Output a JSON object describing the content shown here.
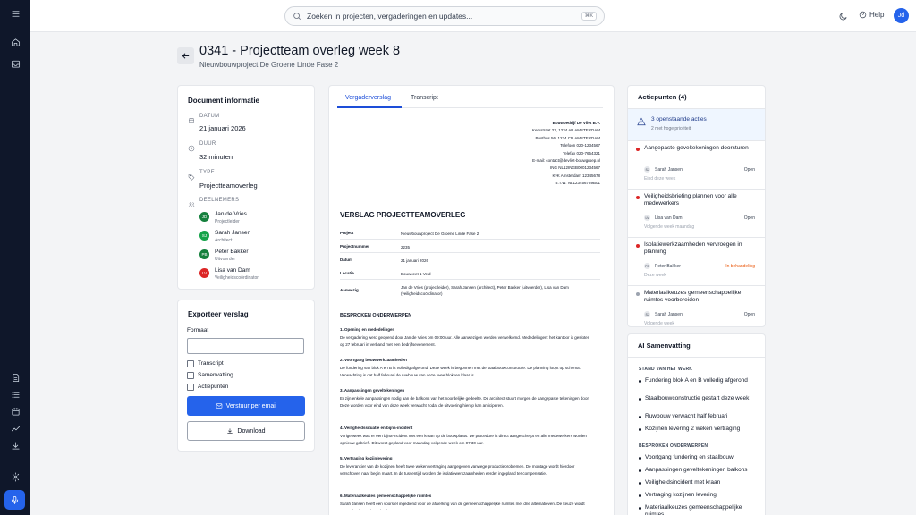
{
  "search": {
    "placeholder": "Zoeken in projecten, vergaderingen en updates...",
    "shortcut": "⌘K"
  },
  "header": {
    "help": "Help",
    "avatar": "Jd"
  },
  "page": {
    "title": "0341 - Projectteam overleg week 8",
    "subtitle": "Nieuwbouwproject De Groene Linde Fase 2"
  },
  "doc_info": {
    "title": "Document informatie",
    "date_label": "DATUM",
    "date": "21 januari 2026",
    "duration_label": "DUUR",
    "duration": "32 minuten",
    "type_label": "TYPE",
    "type": "Projectteamoverleg",
    "participants_label": "DEELNEMERS",
    "participants": [
      {
        "initials": "JD",
        "name": "Jan de Vries",
        "role": "Projectleider",
        "color": "#15803d"
      },
      {
        "initials": "SJ",
        "name": "Sarah Jansen",
        "role": "Architect",
        "color": "#16a34a"
      },
      {
        "initials": "PB",
        "name": "Peter Bakker",
        "role": "Uitvoerder",
        "color": "#15803d"
      },
      {
        "initials": "LV",
        "name": "Lisa van Dam",
        "role": "Veiligheidscoördinator",
        "color": "#dc2626"
      }
    ]
  },
  "export": {
    "title": "Exporteer verslag",
    "format_label": "Formaat",
    "format_value": "",
    "options": [
      "Transcript",
      "Samenvatting",
      "Actiepunten"
    ],
    "email_button": "Verstuur per email",
    "download_button": "Download"
  },
  "tabs": [
    "Vergaderverslag",
    "Transcript"
  ],
  "document": {
    "company": [
      "Bouwbedrijf De Vliet B.V.",
      "Kerkstraat 27, 1234 AB AMSTERDAM",
      "Postbus 56, 1234 CD AMSTERDAM",
      "Telefoon 020-1234567",
      "Telefax 020-7654321",
      "E-mail: contact@devliet-bouwgroep.nl",
      "ING NL12INGB0001234567",
      "KvK Amsterdam 12345678",
      "B.T.W. NL123456789B01"
    ],
    "title": "VERSLAG PROJECTTEAMOVERLEG",
    "meta": [
      {
        "k": "Project",
        "v": "Nieuwbouwproject De Groene Linde Fase 2"
      },
      {
        "k": "Projectnummer",
        "v": "2235"
      },
      {
        "k": "Datum",
        "v": "21 januari 2026"
      },
      {
        "k": "Locatie",
        "v": "Bouwkeet 1 Veld"
      },
      {
        "k": "Aanwezig",
        "v": "Jan de Vries (projectleider), Sarah Jansen (architect), Peter Bakker (uitvoerder), Lisa van Dam (veiligheidscoördinator)"
      }
    ],
    "section_title": "BESPROKEN ONDERWERPEN",
    "topics": [
      {
        "h": "1. Opening en mededelingen",
        "p": "De vergadering werd geopend door Jan de Vries om 09:00 uur. Alle aanwezigen werden verwelkomd. Mededelingen: het kantoor is gesloten op 27 februari in verband met een bedrijfsevenement."
      },
      {
        "h": "2. Voortgang bouwwerkzaamheden",
        "p": "De fundering van blok A en B is volledig afgerond. Deze week is begonnen met de staalbouwconstructie. De planning loopt op schema. Verwachting is dat half februari de ruwbouw van deze twee blokken klaar is."
      },
      {
        "h": "3. Aanpassingen gevelteken­ingen",
        "p": "Er zijn enkele aanpassingen nodig aan de balkons van het noordelijke gedeelte. De architect stuurt morgen de aangepaste tekeningen door. Deze worden voor eind van deze week verwacht zodat de uitvoering hierop kan anticiperen."
      },
      {
        "h": "4. Veiligheidssituatie en bijna-incident",
        "p": "Vorige week was er een bijna-incident met een kraan op de bouwplaats. De procedure is direct aangescherpt en alle medewerkers worden opnieuw gebrieft. Dit wordt gepland voor maandag volgende week om 07:30 uur."
      },
      {
        "h": "5. Vertraging kozijnlevering",
        "p": "De leverancier van de kozijnen heeft twee weken vertraging aangegeven vanwege productieproblemen. De montage wordt hierdoor verschoven naar begin maart. In de tussentijd worden de isolatiewerkzaamheden eerder ingepland ter compensatie."
      },
      {
        "h": "6. Materiaalkeuzes gemeenschappelijke ruimtes",
        "p": "Sarah Jansen heeft een voorstel ingediend voor de afwerking van de gemeenschappelijke ruimtes met drie alternatieven. De keuze wordt voorgelegd aan de opdrachtgever."
      }
    ]
  },
  "actions": {
    "title": "Actiepunten (4)",
    "banner_title": "3 openstaande acties",
    "banner_sub": "2 met hoge prioriteit",
    "items": [
      {
        "title": "Aangepaste geveltekeningen doorsturen",
        "initials": "SJ",
        "person": "Sarah Jansen",
        "status": "Open",
        "due": "Eind deze week",
        "dot": "#dc2626",
        "status_color": "#374151"
      },
      {
        "title": "Veiligheidsbriefing plannen voor alle medewerkers",
        "initials": "LV",
        "person": "Lisa van Dam",
        "status": "Open",
        "due": "Volgende week maandag",
        "dot": "#dc2626",
        "status_color": "#374151"
      },
      {
        "title": "Isolatiewerkzaamheden vervroegen in planning",
        "initials": "PB",
        "person": "Peter Bakker",
        "status": "In behandeling",
        "due": "Deze week",
        "dot": "#dc2626",
        "status_color": "#ea580c"
      },
      {
        "title": "Materiaalkeuzes gemeenschappelijke ruimtes voorbereiden",
        "initials": "SJ",
        "person": "Sarah Jansen",
        "status": "Open",
        "due": "Volgende week",
        "dot": "#9ca3af",
        "status_color": "#374151"
      }
    ]
  },
  "ai": {
    "title": "AI Samenvatting",
    "status_heading": "STAND VAN HET WERK",
    "status_items": [
      "Fundering blok A en B volledig afgerond",
      "Staalbouwconstructie gestart deze week",
      "Ruwbouw verwacht half februari",
      "Kozijnen levering 2 weken vertraging"
    ],
    "topics_heading": "BESPROKEN ONDERWERPEN",
    "topic_items": [
      "Voortgang fundering en staalbouw",
      "Aanpassingen geveltekeningen balkons",
      "Veiligheidsincident met kraan",
      "Vertraging kozijnen levering",
      "Materiaalkeuzes gemeenschappelijke ruimtes"
    ]
  }
}
